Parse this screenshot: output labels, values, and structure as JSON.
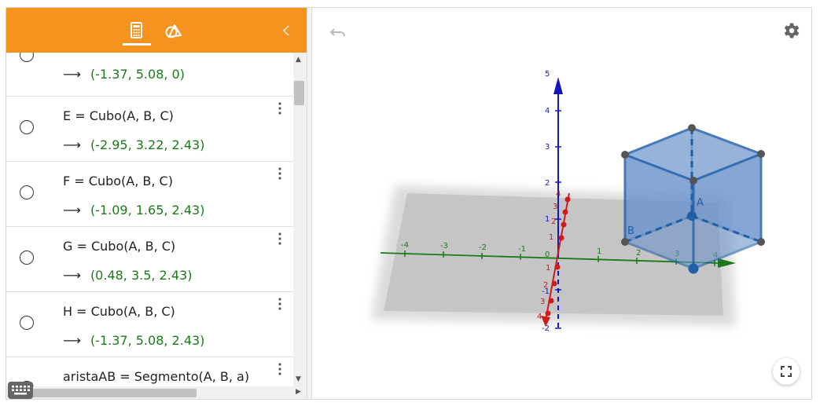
{
  "header": {
    "tabs": [
      {
        "name": "algebra",
        "icon": "calculator-icon",
        "active": true
      },
      {
        "name": "tools",
        "icon": "geometry-tools-icon",
        "active": false
      }
    ],
    "collapse_icon": "chevron-left-icon",
    "color": "#f6921e"
  },
  "algebra": {
    "rows": [
      {
        "definition": "",
        "value": "(-1.37, 5.08, 0)"
      },
      {
        "definition": "E = Cubo(A, B, C)",
        "value": "(-2.95, 3.22, 2.43)"
      },
      {
        "definition": "F = Cubo(A, B, C)",
        "value": "(-1.09, 1.65, 2.43)"
      },
      {
        "definition": "G = Cubo(A, B, C)",
        "value": "(0.48, 3.5, 2.43)"
      },
      {
        "definition": "H = Cubo(A, B, C)",
        "value": "(-1.37, 5.08, 2.43)"
      },
      {
        "definition": "aristaAB = Segmento(A, B, a)",
        "value": ""
      }
    ],
    "arrow": "⟶"
  },
  "graphics": {
    "z_axis_ticks": [
      "1",
      "2",
      "3",
      "4",
      "5"
    ],
    "x_axis_ticks": [
      "-4",
      "-3",
      "-2",
      "-1",
      "0",
      "1",
      "2",
      "3",
      "4"
    ],
    "y_axis_ticks": [
      "1",
      "2",
      "3",
      "4",
      "1",
      "2",
      "3",
      "4"
    ],
    "z_neg_ticks": [
      "-1",
      "-2"
    ],
    "point_labels": {
      "A": "A",
      "B": "B"
    },
    "colors": {
      "z_axis": "#1515c0",
      "x_axis": "#1a7a1a",
      "y_axis": "#d01a1a",
      "cube_fill": "#6c93cc",
      "cube_edge": "#1f5fa8"
    }
  },
  "icons": {
    "undo": "undo-icon",
    "settings": "gear-icon",
    "fullscreen": "fullscreen-icon",
    "keyboard": "keyboard-icon"
  }
}
